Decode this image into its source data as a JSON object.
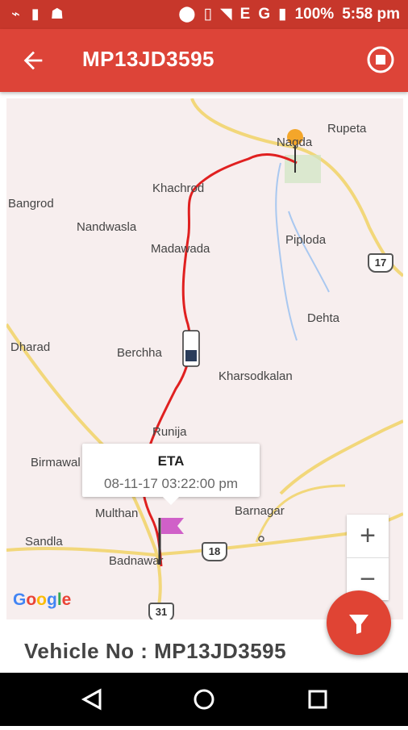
{
  "status_bar": {
    "network": "E",
    "network2": "G",
    "battery": "100%",
    "time": "5:58 pm"
  },
  "app_bar": {
    "title": "MP13JD3595"
  },
  "map": {
    "places": [
      "Rupeta",
      "Nagda",
      "Khachrod",
      "Bangrod",
      "Nandwasla",
      "Madawada",
      "Piploda",
      "Dehta",
      "Dharad",
      "Berchha",
      "Kharsodkalan",
      "Runija",
      "Birmawal",
      "Multhan",
      "Barnagar",
      "Sandla",
      "Badnawar"
    ],
    "highway_shields": [
      "17",
      "18",
      "31"
    ],
    "route_color": "#e02020",
    "attribution": "Google"
  },
  "eta_popup": {
    "title": "ETA",
    "value": "08-11-17 03:22:00 pm"
  },
  "zoom": {
    "in": "+",
    "out": "−"
  },
  "info_panel": {
    "vehicle_text": "Vehicle No : MP13JD3595"
  },
  "colors": {
    "primary": "#dd4438",
    "status_bar": "#c7372b",
    "fab": "#e04434"
  }
}
